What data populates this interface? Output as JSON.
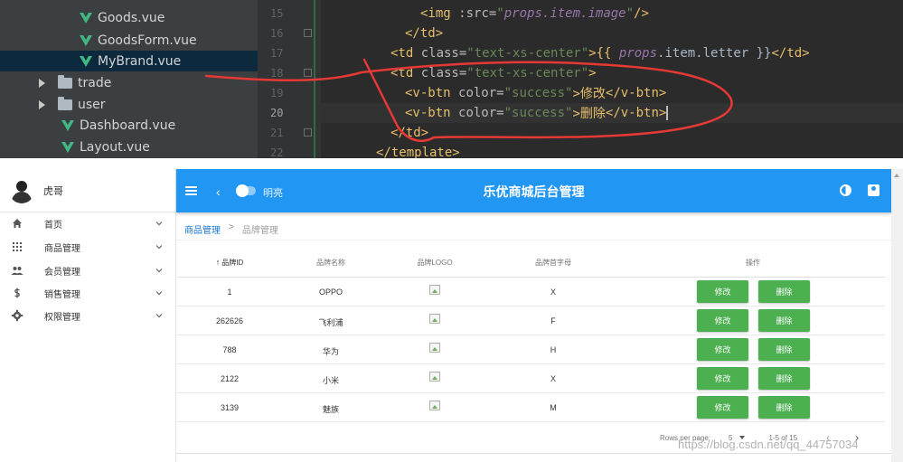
{
  "ide": {
    "tree": [
      {
        "kind": "vue",
        "label": "Goods.vue"
      },
      {
        "kind": "vue",
        "label": "GoodsForm.vue"
      },
      {
        "kind": "vue",
        "label": "MyBrand.vue"
      },
      {
        "kind": "folder",
        "label": "trade"
      },
      {
        "kind": "folder",
        "label": "user"
      },
      {
        "kind": "vue",
        "label": "Dashboard.vue"
      },
      {
        "kind": "vue",
        "label": "Layout.vue"
      }
    ],
    "line_numbers": [
      "15",
      "16",
      "17",
      "18",
      "19",
      "20",
      "21",
      "22"
    ],
    "code": {
      "l15_a": "<img ",
      "l15_b": ":src=",
      "l15_c": "\"",
      "l15_d": "props.item.image",
      "l15_e": "\"",
      "l15_f": "/>",
      "l16_a": "</td>",
      "l17_a": "<td ",
      "l17_b": "class=",
      "l17_c": "\"text-xs-center\"",
      "l17_d": ">{{ ",
      "l17_e": "props",
      "l17_f": ".item.letter }}",
      "l17_g": "</td>",
      "l18_a": "<td ",
      "l18_b": "class=",
      "l18_c": "\"text-xs-center\"",
      "l18_d": ">",
      "l19_a": "<v-btn ",
      "l19_b": "color=",
      "l19_c": "\"success\"",
      "l19_d": ">修改",
      "l19_e": "</v-btn>",
      "l20_a": "<v-btn ",
      "l20_b": "color=",
      "l20_c": "\"success\"",
      "l20_d": ">删除",
      "l20_e": "</v-btn>",
      "l21_a": "</td>",
      "l22_a": "</template>"
    }
  },
  "app": {
    "user_name": "虎哥",
    "nav": [
      {
        "label": "首页",
        "icon": "home-icon"
      },
      {
        "label": "商品管理",
        "icon": "apps-icon"
      },
      {
        "label": "会员管理",
        "icon": "people-icon"
      },
      {
        "label": "销售管理",
        "icon": "dollar-icon"
      },
      {
        "label": "权限管理",
        "icon": "settings-icon"
      }
    ],
    "topbar": {
      "back": "‹",
      "toggle_label": "明亮",
      "title": "乐优商城后台管理"
    },
    "breadcrumb": {
      "parent": "商品管理",
      "separator": ">",
      "current": "品牌管理"
    },
    "table": {
      "headers": [
        "品牌ID",
        "品牌名称",
        "品牌LOGO",
        "品牌首字母",
        "操作"
      ],
      "rows": [
        {
          "id": "1",
          "name": "OPPO",
          "letter": "X"
        },
        {
          "id": "262626",
          "name": "飞利浦",
          "letter": "F"
        },
        {
          "id": "788",
          "name": "华为",
          "letter": "H"
        },
        {
          "id": "2122",
          "name": "小米",
          "letter": "X"
        },
        {
          "id": "3139",
          "name": "魅族",
          "letter": "M"
        }
      ],
      "edit_label": "修改",
      "delete_label": "删除",
      "sort_icon": "arrow-up-icon"
    },
    "footer": {
      "rows_per_page_label": "Rows per page:",
      "rows_per_page": "5",
      "page_info": "1-5 of 15",
      "prev": "‹",
      "next": "›"
    },
    "watermark": "https://blog.csdn.net/qq_44757034",
    "colors": {
      "primary": "#2196f3",
      "success": "#4caf50",
      "annotation": "#e53935"
    }
  }
}
